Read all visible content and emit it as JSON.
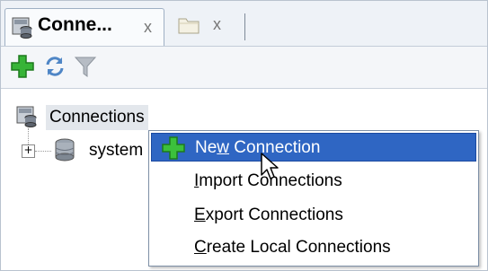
{
  "tabs": [
    {
      "label": "Conne...",
      "close": "x",
      "active": true
    },
    {
      "label": "",
      "close": "x",
      "active": false
    }
  ],
  "toolbar": {
    "add_icon": "plus-icon",
    "refresh_icon": "refresh-icon",
    "filter_icon": "filter-icon"
  },
  "tree": {
    "root": {
      "label": "Connections",
      "icon": "connections-icon"
    },
    "children": [
      {
        "label": "system",
        "expander": "⊞",
        "icon": "database-icon"
      }
    ]
  },
  "context_menu": {
    "items": [
      {
        "label": "New Connection",
        "mnemonic_index": 2,
        "selected": true,
        "icon": "plus-icon"
      },
      {
        "label": "Import Connections",
        "mnemonic_index": 0,
        "selected": false
      },
      {
        "label": "Export Connections",
        "mnemonic_index": 0,
        "selected": false
      },
      {
        "label": "Create Local Connections",
        "mnemonic_index": 0,
        "selected": false
      }
    ]
  },
  "colors": {
    "selection": "#2f66c3",
    "plus_green": "#2fae2f",
    "refresh_blue": "#4f86c6"
  }
}
